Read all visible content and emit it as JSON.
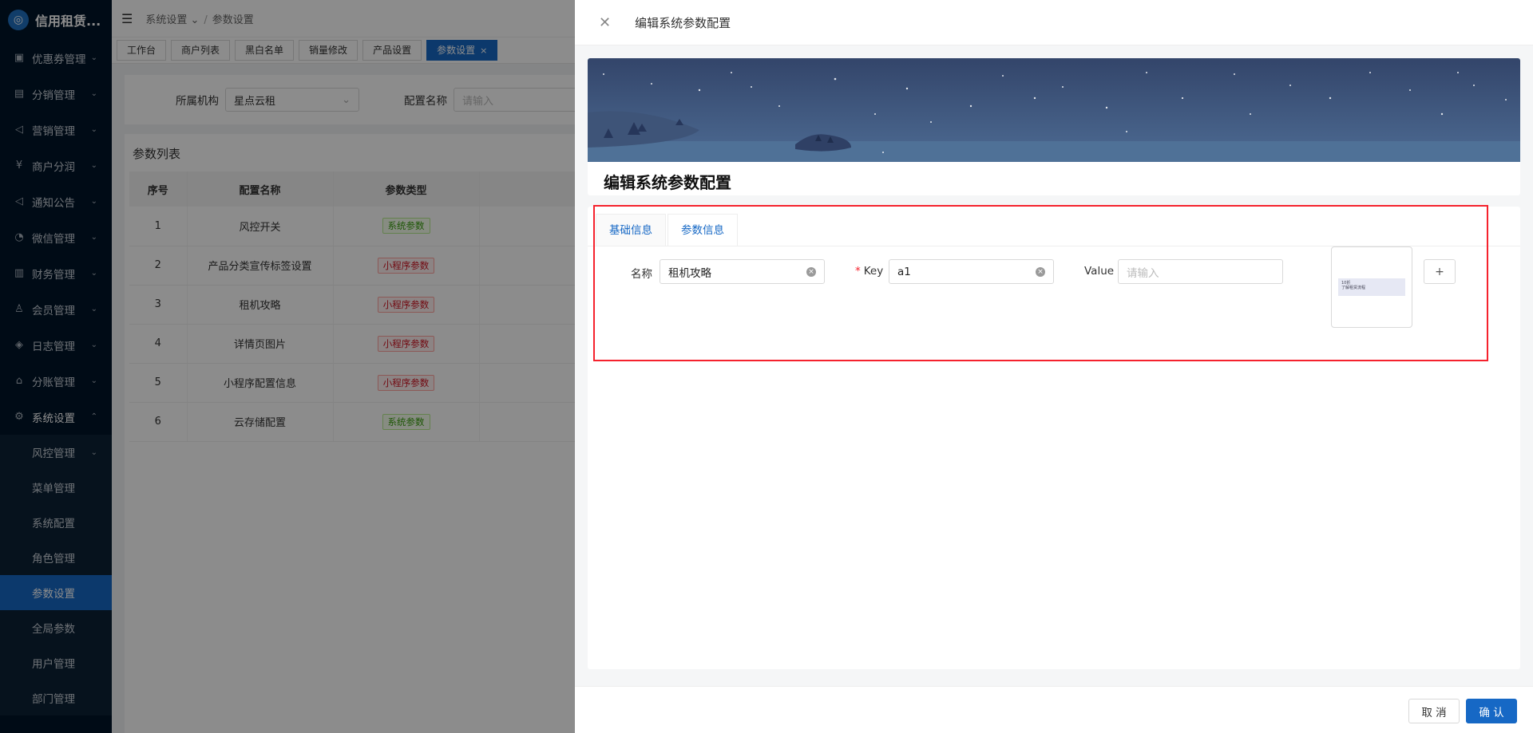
{
  "app": {
    "title": "信用租赁..."
  },
  "sidebar": {
    "items": [
      {
        "label": "优惠券管理",
        "icon": "gift-icon"
      },
      {
        "label": "分销管理",
        "icon": "distribution-icon"
      },
      {
        "label": "营销管理",
        "icon": "megaphone-icon"
      },
      {
        "label": "商户分润",
        "icon": "yen-icon"
      },
      {
        "label": "通知公告",
        "icon": "notification-icon"
      },
      {
        "label": "微信管理",
        "icon": "wechat-icon"
      },
      {
        "label": "财务管理",
        "icon": "finance-icon"
      },
      {
        "label": "会员管理",
        "icon": "user-icon"
      },
      {
        "label": "日志管理",
        "icon": "log-icon"
      },
      {
        "label": "分账管理",
        "icon": "split-icon"
      },
      {
        "label": "系统设置",
        "icon": "gear-icon"
      }
    ],
    "sub_items": [
      {
        "label": "风控管理"
      },
      {
        "label": "菜单管理"
      },
      {
        "label": "系统配置"
      },
      {
        "label": "角色管理"
      },
      {
        "label": "参数设置"
      },
      {
        "label": "全局参数"
      },
      {
        "label": "用户管理"
      },
      {
        "label": "部门管理"
      }
    ]
  },
  "breadcrumb": {
    "parent": "系统设置",
    "current": "参数设置"
  },
  "page_tabs": [
    {
      "label": "工作台"
    },
    {
      "label": "商户列表"
    },
    {
      "label": "黑白名单"
    },
    {
      "label": "销量修改"
    },
    {
      "label": "产品设置"
    },
    {
      "label": "参数设置"
    }
  ],
  "filter": {
    "org_label": "所属机构",
    "org_value": "星点云租",
    "name_label": "配置名称",
    "name_placeholder": "请输入"
  },
  "list": {
    "title": "参数列表",
    "columns": [
      "序号",
      "配置名称",
      "参数类型"
    ],
    "rows": [
      {
        "no": "1",
        "name": "风控开关",
        "type": "系统参数"
      },
      {
        "no": "2",
        "name": "产品分类宣传标签设置",
        "type": "小程序参数"
      },
      {
        "no": "3",
        "name": "租机攻略",
        "type": "小程序参数"
      },
      {
        "no": "4",
        "name": "详情页图片",
        "type": "小程序参数"
      },
      {
        "no": "5",
        "name": "小程序配置信息",
        "type": "小程序参数"
      },
      {
        "no": "6",
        "name": "云存储配置",
        "type": "系统参数"
      }
    ]
  },
  "drawer": {
    "header_title": "编辑系统参数配置",
    "banner_title": "编辑系统参数配置",
    "tabs": [
      {
        "label": "基础信息"
      },
      {
        "label": "参数信息"
      }
    ],
    "form": {
      "name_label": "名称",
      "name_value": "租机攻略",
      "key_required": "*",
      "key_label": "Key",
      "key_value": "a1",
      "value_label": "Value",
      "value_placeholder": "请输入",
      "thumb_line1": "10折",
      "thumb_line2": "了解租赁流程",
      "add_label": "+"
    },
    "footer": {
      "cancel": "取 消",
      "ok": "确 认"
    }
  },
  "colors": {
    "primary": "#1668c5",
    "sidebar": "#001529",
    "highlight": "#f5222d"
  }
}
